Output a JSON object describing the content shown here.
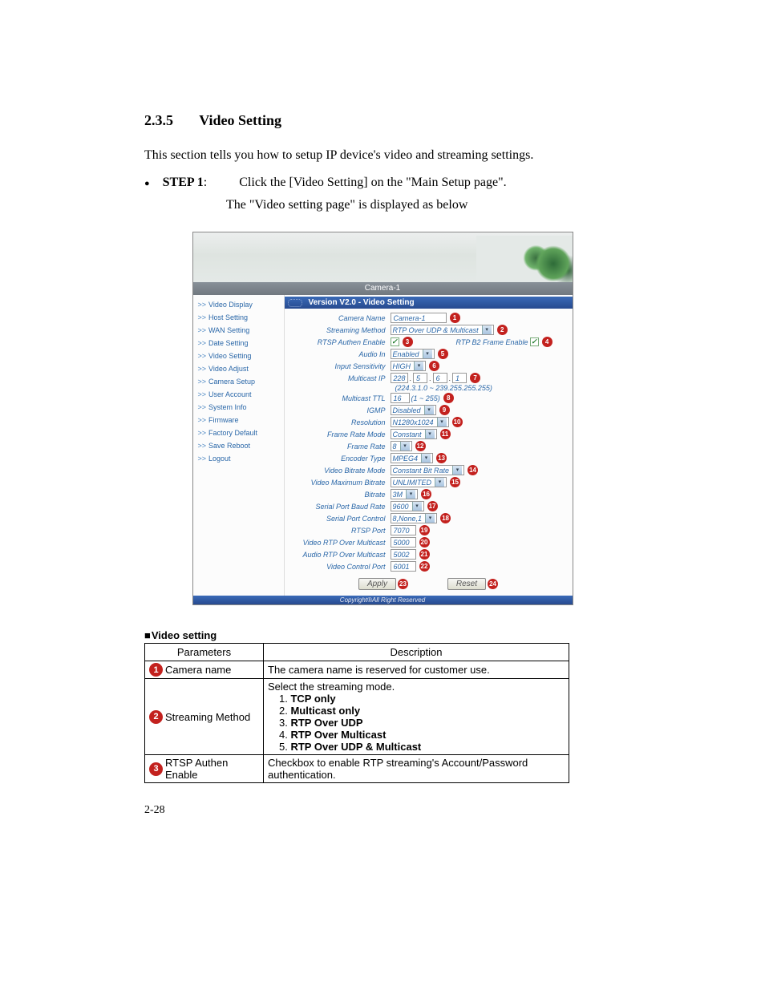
{
  "section": {
    "number": "2.3.5",
    "title": "Video Setting"
  },
  "intro": "This section tells you how to setup IP device's video and streaming settings.",
  "step": {
    "label": "STEP 1",
    "colon": ":",
    "text": "Click the [Video Setting] on the \"Main Setup page\".",
    "subtext": "The \"Video setting page\" is displayed as below"
  },
  "screenshot": {
    "titlebar": "Camera-1",
    "subtitle": "Version V2.0 - Video Setting",
    "copyright": "Copyright®All Right Reserved",
    "sidebar": [
      "Video Display",
      "Host Setting",
      "WAN Setting",
      "Date Setting",
      "Video Setting",
      "Video Adjust",
      "Camera Setup",
      "User Account",
      "System Info",
      "Firmware",
      "Factory Default",
      "Save Reboot",
      "Logout"
    ],
    "rows": {
      "camera_name": {
        "label": "Camera Name",
        "value": "Camera-1",
        "badge": "1"
      },
      "streaming_method": {
        "label": "Streaming Method",
        "value": "RTP Over UDP & Multicast",
        "badge": "2"
      },
      "rtsp_authen": {
        "label": "RTSP Authen Enable",
        "badge": "3"
      },
      "b2frame": {
        "label": "RTP B2 Frame Enable",
        "badge": "4"
      },
      "audio_in": {
        "label": "Audio In",
        "value": "Enabled",
        "badge": "5"
      },
      "input_sens": {
        "label": "Input Sensitivity",
        "value": "HIGH",
        "badge": "6"
      },
      "multicast_ip": {
        "label": "Multicast IP",
        "v1": "228",
        "v2": "5",
        "v3": "6",
        "v4": "1",
        "badge": "7",
        "hint": "(224.3.1.0 ~ 239.255.255.255)"
      },
      "multicast_ttl": {
        "label": "Multicast TTL",
        "value": "16",
        "hint": "(1 ~ 255)",
        "badge": "8"
      },
      "igmp": {
        "label": "IGMP",
        "value": "Disabled",
        "badge": "9"
      },
      "resolution": {
        "label": "Resolution",
        "value": "N1280x1024",
        "badge": "10"
      },
      "frame_rate_mode": {
        "label": "Frame Rate Mode",
        "value": "Constant",
        "badge": "11"
      },
      "frame_rate": {
        "label": "Frame Rate",
        "value": "8",
        "badge": "12"
      },
      "encoder_type": {
        "label": "Encoder Type",
        "value": "MPEG4",
        "badge": "13"
      },
      "video_bitrate_mode": {
        "label": "Video Bitrate Mode",
        "value": "Constant Bit Rate",
        "badge": "14"
      },
      "video_max_bitrate": {
        "label": "Video Maximum Bitrate",
        "value": "UNLIMITED",
        "badge": "15"
      },
      "bitrate": {
        "label": "Bitrate",
        "value": "3M",
        "badge": "16"
      },
      "serial_baud": {
        "label": "Serial Port Baud Rate",
        "value": "9600",
        "badge": "17"
      },
      "serial_ctrl": {
        "label": "Serial Port Control",
        "value": "8,None,1",
        "badge": "18"
      },
      "rtsp_port": {
        "label": "RTSP Port",
        "value": "7070",
        "badge": "19"
      },
      "video_rtp": {
        "label": "Video RTP Over Multicast",
        "value": "5000",
        "badge": "20"
      },
      "audio_rtp": {
        "label": "Audio RTP Over Multicast",
        "value": "5002",
        "badge": "21"
      },
      "video_ctrl_port": {
        "label": "Video Control Port",
        "value": "6001",
        "badge": "22"
      },
      "apply": {
        "label": "Apply",
        "badge": "23"
      },
      "reset": {
        "label": "Reset",
        "badge": "24"
      }
    }
  },
  "table": {
    "heading": "Video setting",
    "head_param": "Parameters",
    "head_desc": "Description",
    "rows": [
      {
        "badge": "1",
        "param": "Camera name",
        "desc_plain": "The camera name is reserved for customer use."
      },
      {
        "badge": "2",
        "param": "Streaming Method",
        "desc_lead": "Select the streaming mode.",
        "opts": [
          {
            "n": "1. ",
            "t": "TCP only"
          },
          {
            "n": "2. ",
            "t": "Multicast only"
          },
          {
            "n": "3. ",
            "t": "RTP Over UDP"
          },
          {
            "n": "4. ",
            "t": "RTP Over Multicast"
          },
          {
            "n": "5. ",
            "t": "RTP Over UDP & Multicast"
          }
        ]
      },
      {
        "badge": "3",
        "param": "RTSP Authen Enable",
        "desc_plain": "Checkbox to enable RTP streaming's Account/Password authentication."
      }
    ]
  },
  "page_number": "2-28"
}
